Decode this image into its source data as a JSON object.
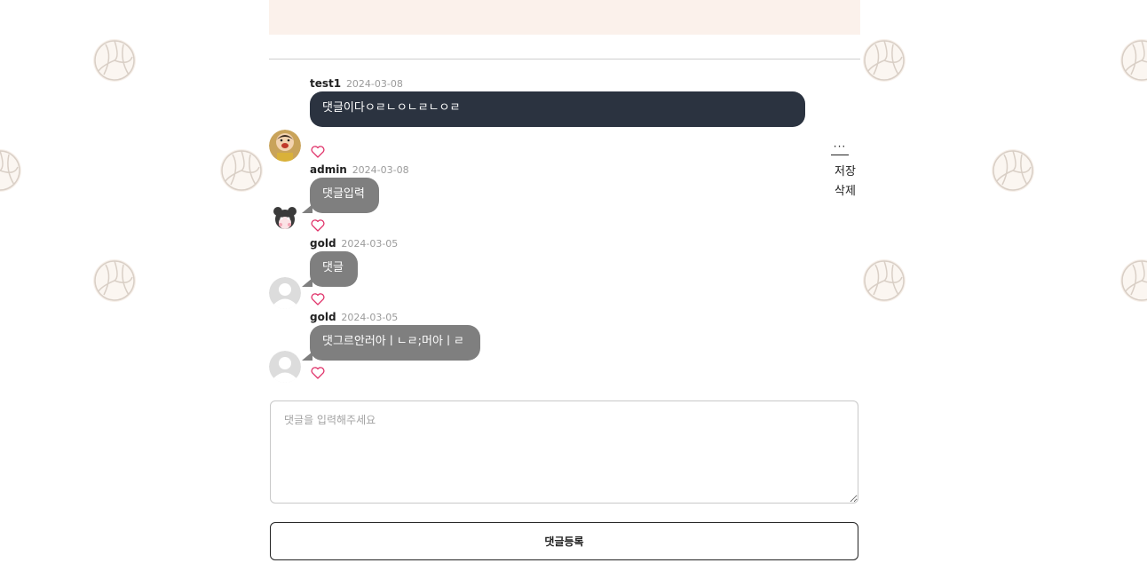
{
  "comments": [
    {
      "author": "test1",
      "date": "2024-03-08",
      "text": "댓글이다ㅇㄹㄴㅇㄴㄹㄴㅇㄹ",
      "mine": true,
      "avatar": "crayon-shin-chan-avatar"
    },
    {
      "author": "admin",
      "date": "2024-03-08",
      "text": "댓글입력",
      "mine": false,
      "avatar": "cartoon-character-avatar"
    },
    {
      "author": "gold",
      "date": "2024-03-05",
      "text": "댓글",
      "mine": false,
      "avatar": "default-user-avatar"
    },
    {
      "author": "gold",
      "date": "2024-03-05",
      "text": "댓그르안러아ㅣㄴㄹ;머아ㅣㄹ",
      "mine": false,
      "avatar": "default-user-avatar"
    }
  ],
  "more_menu": {
    "dots": "···",
    "save_label": "저장",
    "delete_label": "삭제"
  },
  "comment_form": {
    "placeholder": "댓글을 입력해주세요",
    "submit_label": "댓글등록"
  },
  "colors": {
    "my_bubble": "#2b3340",
    "other_bubble": "#7f7f7f",
    "heart": "#e0336a",
    "top_band": "#fbf1eb"
  },
  "icons": {
    "like": "heart-outline-icon",
    "background_pattern": "volleyball-icon"
  }
}
